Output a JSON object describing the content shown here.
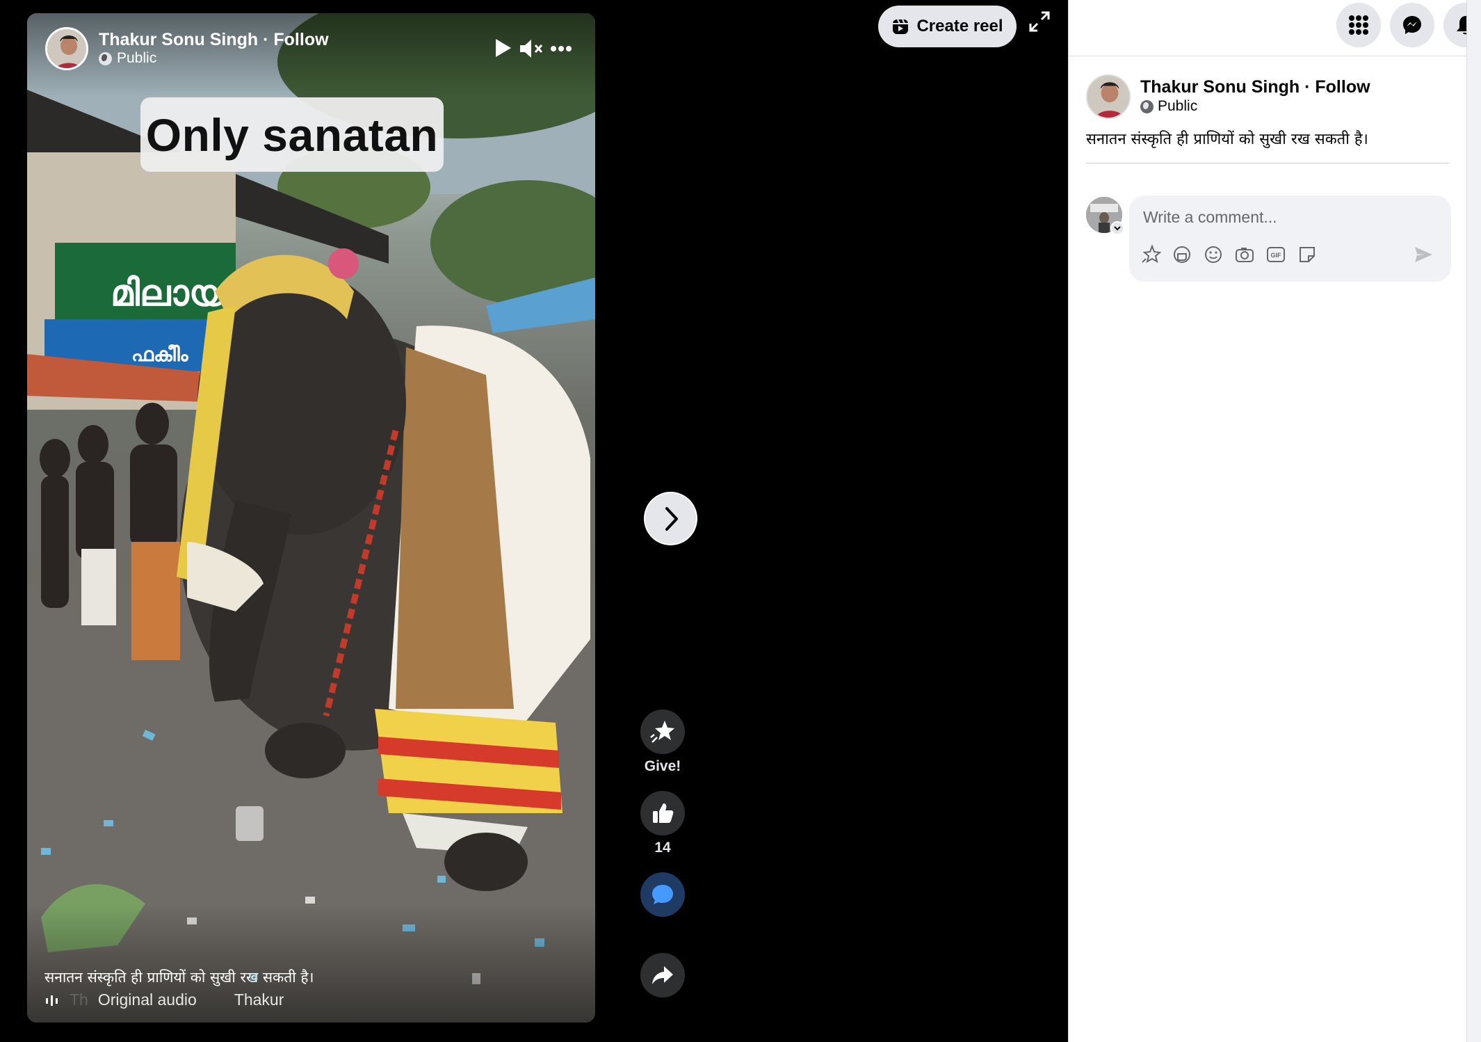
{
  "reel": {
    "author_name": "Thakur Sonu Singh · Follow",
    "privacy": "Public",
    "overlay_caption": "Only sanatan",
    "description": "सनातन संस्कृति ही प्राणियों को सुखी रख सकती है।",
    "audio_prefix": "Th",
    "audio_label": "Original audio",
    "audio_artist": "Thakur"
  },
  "top": {
    "create_reel_label": "Create reel"
  },
  "actions": {
    "give_label": "Give!",
    "like_count": "14"
  },
  "panel": {
    "author_name": "Thakur Sonu Singh · Follow",
    "privacy": "Public",
    "description": "सनातन संस्कृति ही प्राणियों को सुखी रख सकती है।",
    "comment_placeholder": "Write a comment..."
  },
  "colors": {
    "comment_active": "#1f3a63",
    "accent_blue": "#4599ff",
    "badge_red": "#e41e3f"
  },
  "icons": [
    "play-icon",
    "mute-icon",
    "more-icon",
    "globe-icon",
    "next-chevron-icon",
    "give-star-icon",
    "like-icon",
    "comment-icon",
    "share-icon",
    "reel-icon",
    "expand-icon",
    "menu-grid-icon",
    "messenger-icon",
    "bell-icon",
    "avatar-star-icon",
    "sticker-icon",
    "emoji-icon",
    "camera-icon",
    "gif-icon",
    "sticker-square-icon",
    "send-icon"
  ]
}
